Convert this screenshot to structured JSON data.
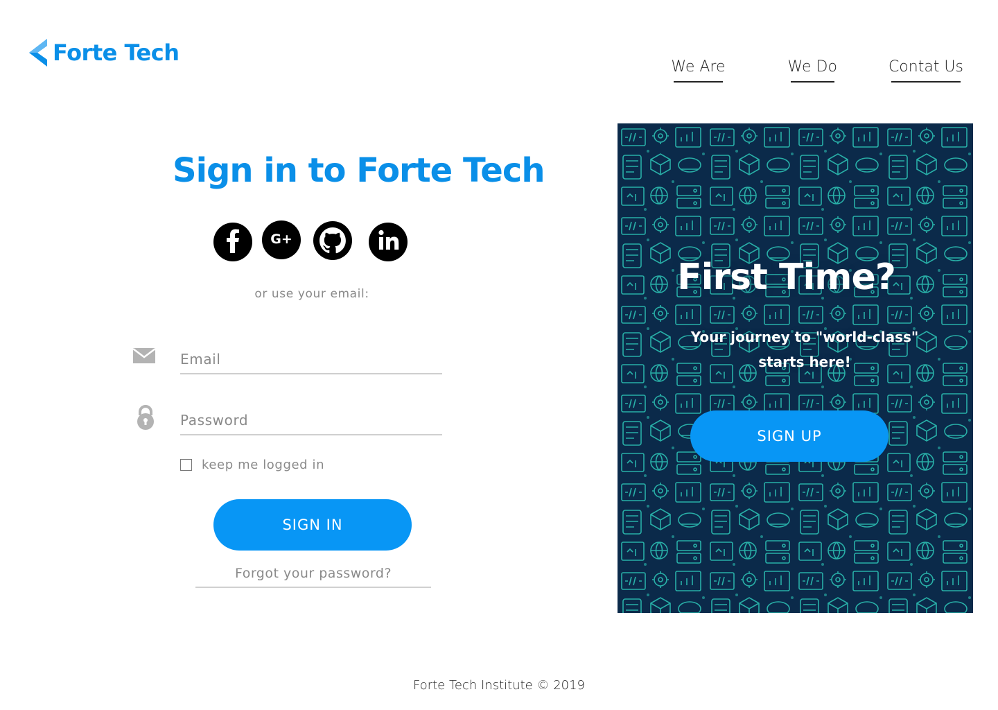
{
  "brand": {
    "name": "Forte Tech",
    "color": "#0a8fe8"
  },
  "nav": {
    "items": [
      {
        "label": "We Are"
      },
      {
        "label": "We Do"
      },
      {
        "label": "Contat Us"
      }
    ]
  },
  "signin": {
    "title": "Sign in to Forte Tech",
    "social": [
      "facebook-icon",
      "google-plus-icon",
      "github-icon",
      "linkedin-icon"
    ],
    "or_email": "or use your email:",
    "email_placeholder": "Email",
    "password_placeholder": "Password",
    "remember_label": "keep me logged in",
    "submit_label": "SIGN IN",
    "forgot_label": "Forgot your password?"
  },
  "panel": {
    "title": "First Time?",
    "subtitle_line1": "Your journey to \"world-class\"",
    "subtitle_line2": "starts here!",
    "button_label": "SIGN UP",
    "pattern_color": "#2cc7b8",
    "background": "#0b2a4a"
  },
  "footer": {
    "text": "Forte Tech Institute © 2019"
  },
  "colors": {
    "accent": "#0896f5",
    "muted": "#8a8a8a"
  }
}
